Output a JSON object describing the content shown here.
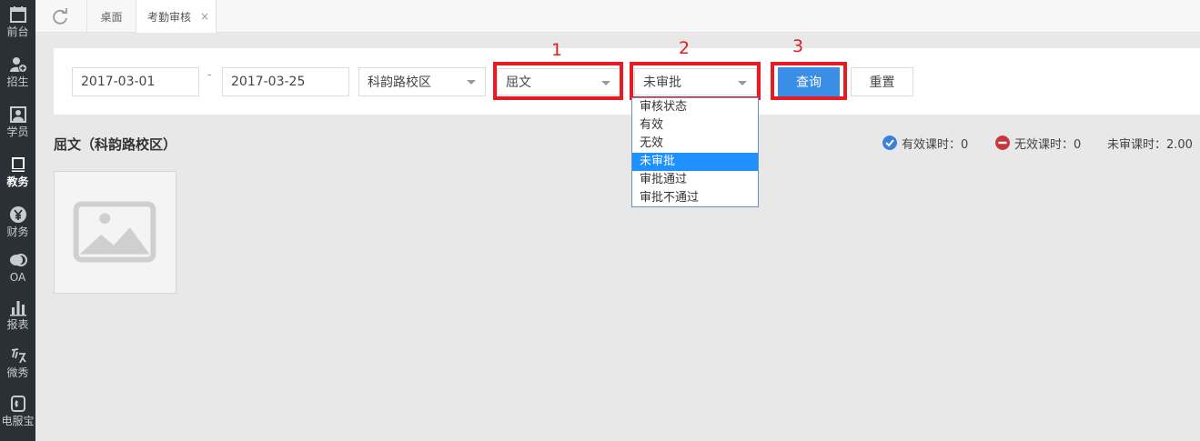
{
  "sidebar": {
    "items": [
      {
        "label": "前台",
        "icon": "calendar-icon"
      },
      {
        "label": "招生",
        "icon": "add-user-icon"
      },
      {
        "label": "学员",
        "icon": "student-icon"
      },
      {
        "label": "教务",
        "icon": "book-icon"
      },
      {
        "label": "财务",
        "icon": "yen-icon"
      },
      {
        "label": "OA",
        "icon": "chat-icon"
      },
      {
        "label": "报表",
        "icon": "bar-chart-icon"
      },
      {
        "label": "微秀",
        "icon": "xiu-icon"
      },
      {
        "label": "电服宝",
        "icon": "phone-icon"
      }
    ],
    "active_index": 3
  },
  "tabs": {
    "refresh_icon": "refresh-icon",
    "items": [
      {
        "label": "桌面"
      },
      {
        "label": "考勤审核",
        "close": "×"
      }
    ]
  },
  "filters": {
    "start_date": "2017-03-01",
    "separator": "-",
    "end_date": "2017-03-25",
    "campus": "科韵路校区",
    "teacher": "屈文",
    "status": "未审批",
    "query_label": "查询",
    "reset_label": "重置"
  },
  "annotations": [
    "1",
    "2",
    "3"
  ],
  "status_options": [
    {
      "label": "审核状态"
    },
    {
      "label": "有效"
    },
    {
      "label": "无效"
    },
    {
      "label": "未审批",
      "selected": true
    },
    {
      "label": "审批通过"
    },
    {
      "label": "审批不通过"
    }
  ],
  "content": {
    "title": "屈文（科韵路校区）",
    "stats": {
      "valid": "有效课时：0",
      "invalid": "无效课时：0",
      "unapproved": "未审课时：2.00"
    }
  },
  "colors": {
    "sidebar_bg": "#2b3036",
    "accent": "#3a8ee6",
    "annotation": "#e81a22",
    "selected_option": "#1e90ff"
  }
}
